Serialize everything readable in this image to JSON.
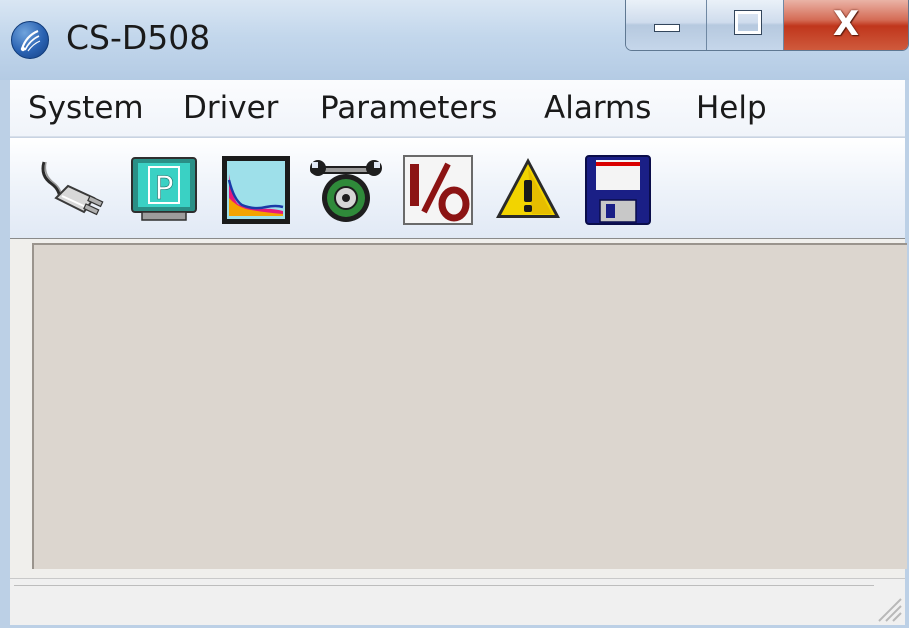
{
  "window": {
    "title": "CS-D508",
    "app_icon": "app-logo-icon",
    "caption_buttons": {
      "minimize": "minimize-icon",
      "maximize": "maximize-icon",
      "close_glyph": "X"
    }
  },
  "menubar": {
    "items": [
      {
        "label": "System"
      },
      {
        "label": "Driver"
      },
      {
        "label": "Parameters"
      },
      {
        "label": "Alarms"
      },
      {
        "label": "Help"
      }
    ]
  },
  "toolbar": {
    "buttons": [
      {
        "icon": "plug-connect-icon"
      },
      {
        "icon": "parameters-monitor-icon",
        "glyph": "P"
      },
      {
        "icon": "oscilloscope-chart-icon"
      },
      {
        "icon": "wrench-disc-settings-icon"
      },
      {
        "icon": "io-icon",
        "glyph": "I/O"
      },
      {
        "icon": "warning-icon",
        "glyph": "!"
      },
      {
        "icon": "save-floppy-icon"
      }
    ]
  },
  "colors": {
    "titlebar": "#c3d7ec",
    "menubar": "#f0f4fa",
    "client_background": "#dcd6cf",
    "close_button": "#c0361c",
    "io_icon_red": "#8c1414",
    "warning_yellow": "#f2d400",
    "floppy_blue": "#1a1f86"
  }
}
